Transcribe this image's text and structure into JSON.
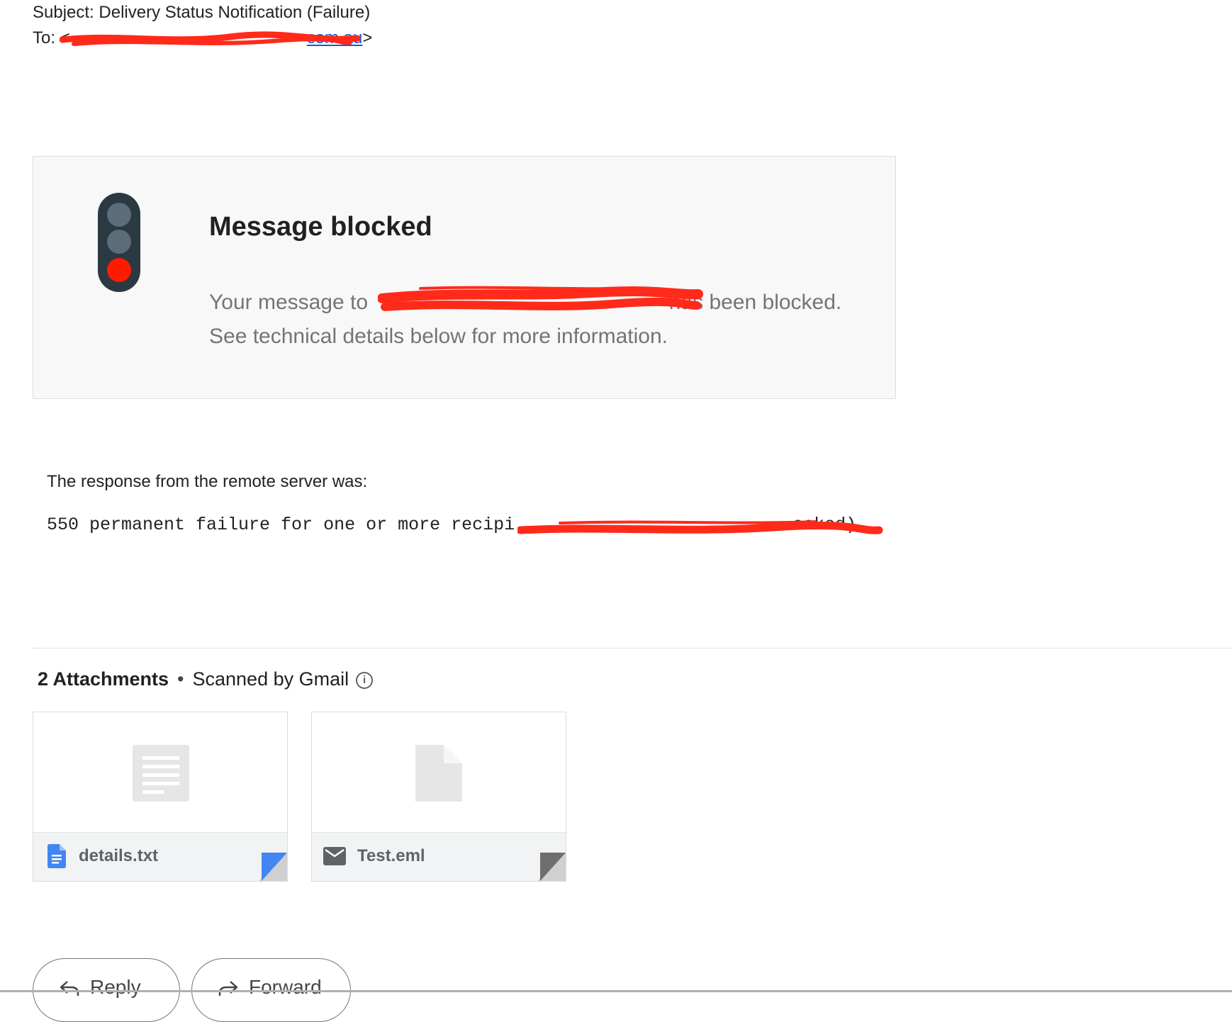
{
  "header": {
    "subject": "Subject: Delivery Status Notification (Failure)",
    "to_label": "To:",
    "to_open": "<",
    "to_email_visible": "com.au",
    "to_close": ">"
  },
  "notice": {
    "title": "Message blocked",
    "body_prefix": "Your message to",
    "body_suffix": "has been blocked.",
    "body_line2": "See technical details below for more information."
  },
  "response": {
    "label": "The response from the remote server was:",
    "code_prefix": "550 permanent failure for one or more recipi",
    "code_suffix": "ocked)"
  },
  "attachments": {
    "count_label": "2 Attachments",
    "separator": "•",
    "scanned_label": "Scanned by Gmail",
    "files": [
      {
        "name": "details.txt",
        "icon": "doc-icon",
        "corner_color": "#4285f4"
      },
      {
        "name": "Test.eml",
        "icon": "mail-icon",
        "corner_color": "#5f6368"
      }
    ]
  },
  "actions": {
    "reply_label": "Reply",
    "forward_label": "Forward"
  },
  "colors": {
    "redaction": "#ff2a1a",
    "red_light": "#ff1a00",
    "traffic_body": "#2b3943",
    "link": "#1a56db"
  }
}
